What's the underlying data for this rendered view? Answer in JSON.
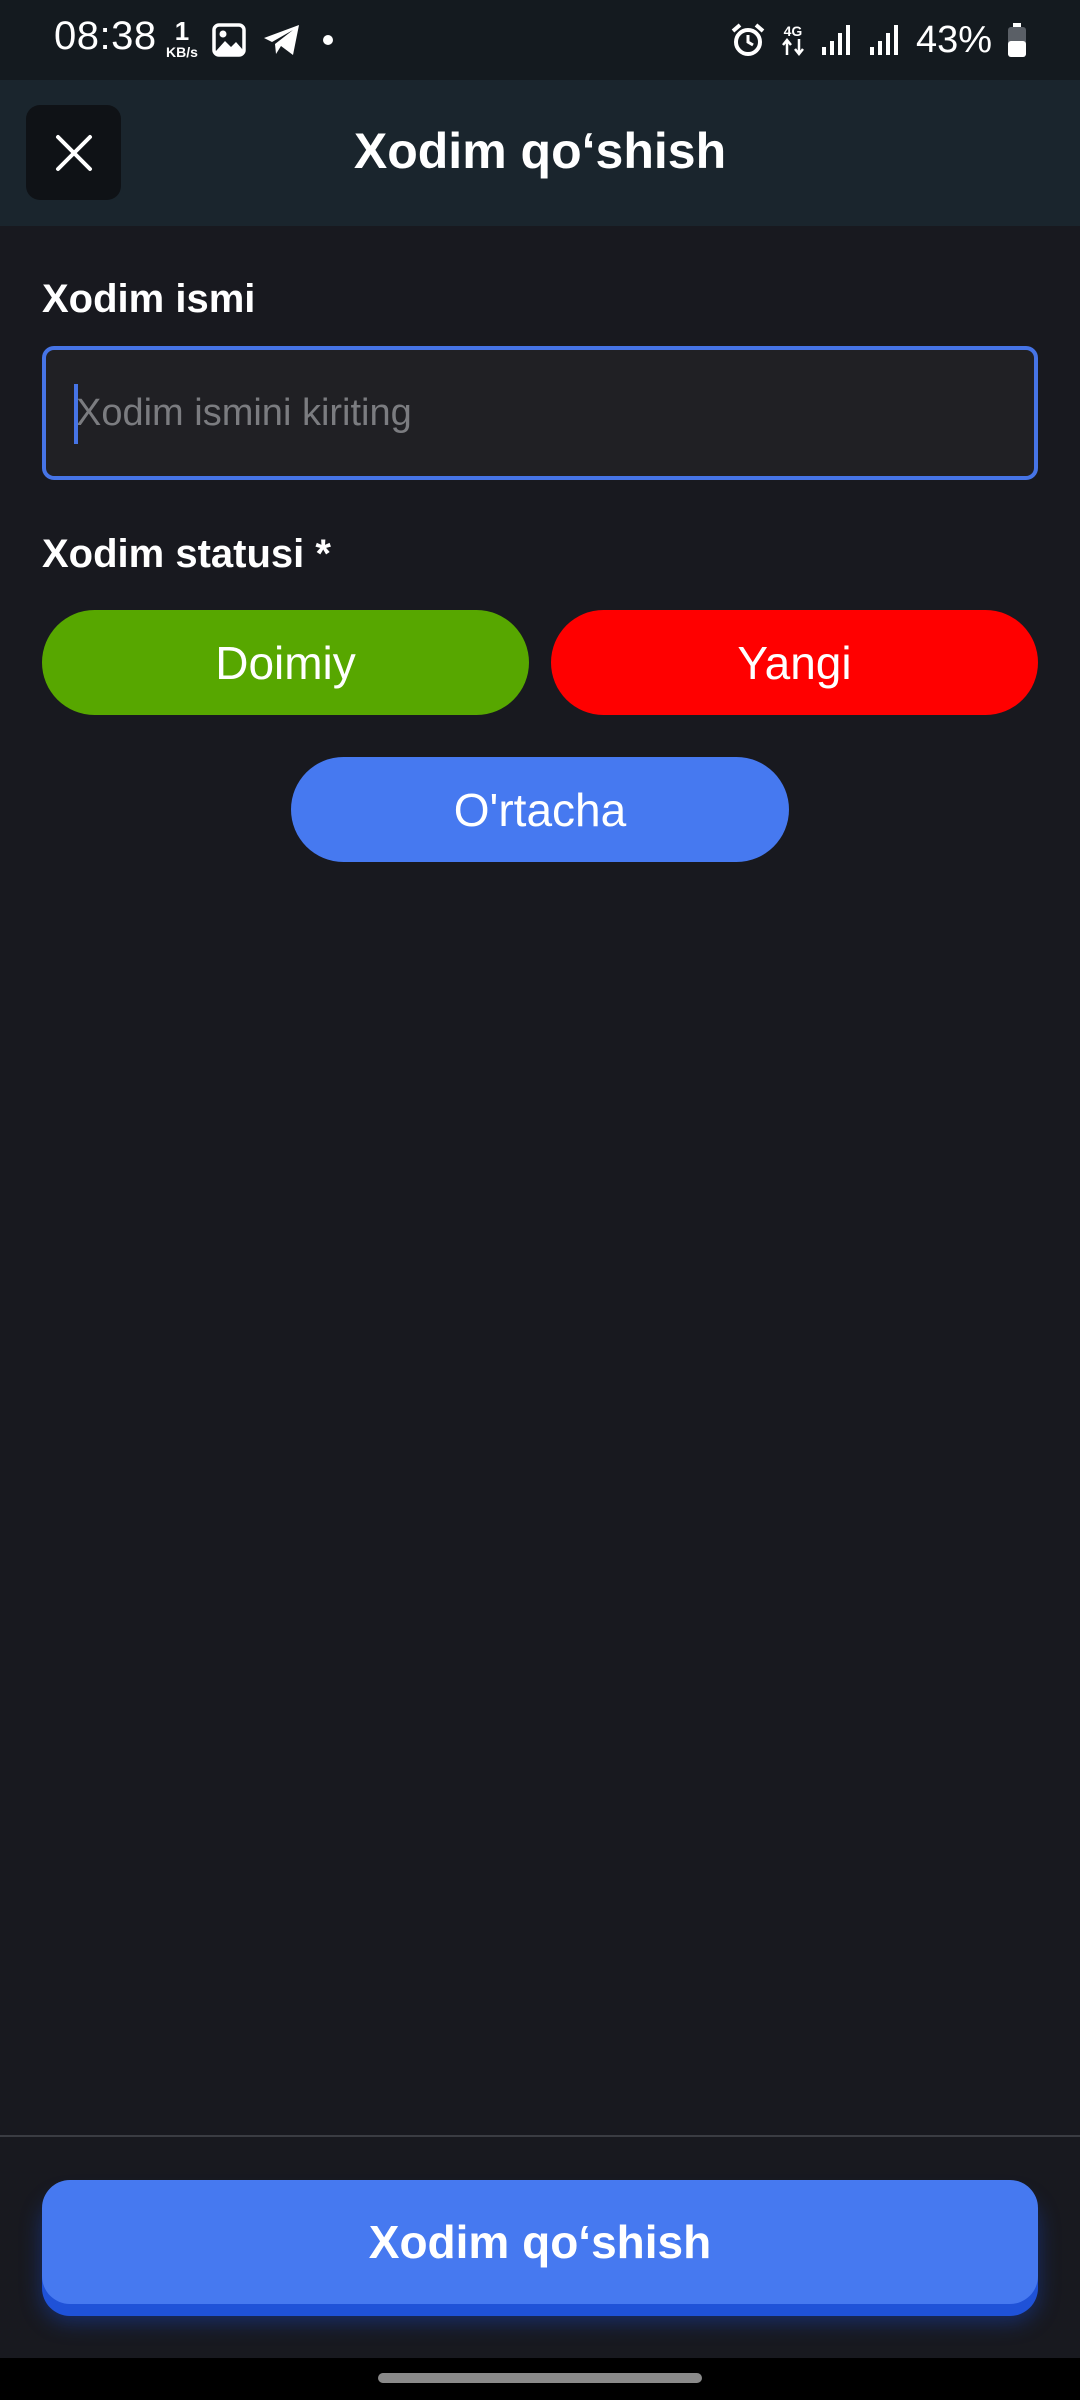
{
  "status_bar": {
    "time": "08:38",
    "speed_value": "1",
    "speed_unit": "KB/s",
    "network": "4G",
    "battery": "43%",
    "icons": [
      "image-icon",
      "telegram-icon",
      "dot-icon",
      "alarm-icon",
      "data-arrows-icon",
      "signal-icon",
      "signal-icon",
      "battery-icon"
    ]
  },
  "header": {
    "title": "Xodim qo‘shish",
    "close_icon": "close-icon"
  },
  "form": {
    "name_label": "Xodim ismi",
    "name_placeholder": "Xodim ismini kiriting",
    "name_value": "",
    "status_label": "Xodim statusi *",
    "status_options": [
      {
        "label": "Doimiy",
        "color": "#57a700"
      },
      {
        "label": "Yangi",
        "color": "#ff0000"
      },
      {
        "label": "O'rtacha",
        "color": "#4679f0"
      }
    ]
  },
  "footer": {
    "submit_label": "Xodim qo‘shish"
  },
  "colors": {
    "background": "#18191f",
    "header": "#1a252d",
    "accent": "#4679f0"
  }
}
